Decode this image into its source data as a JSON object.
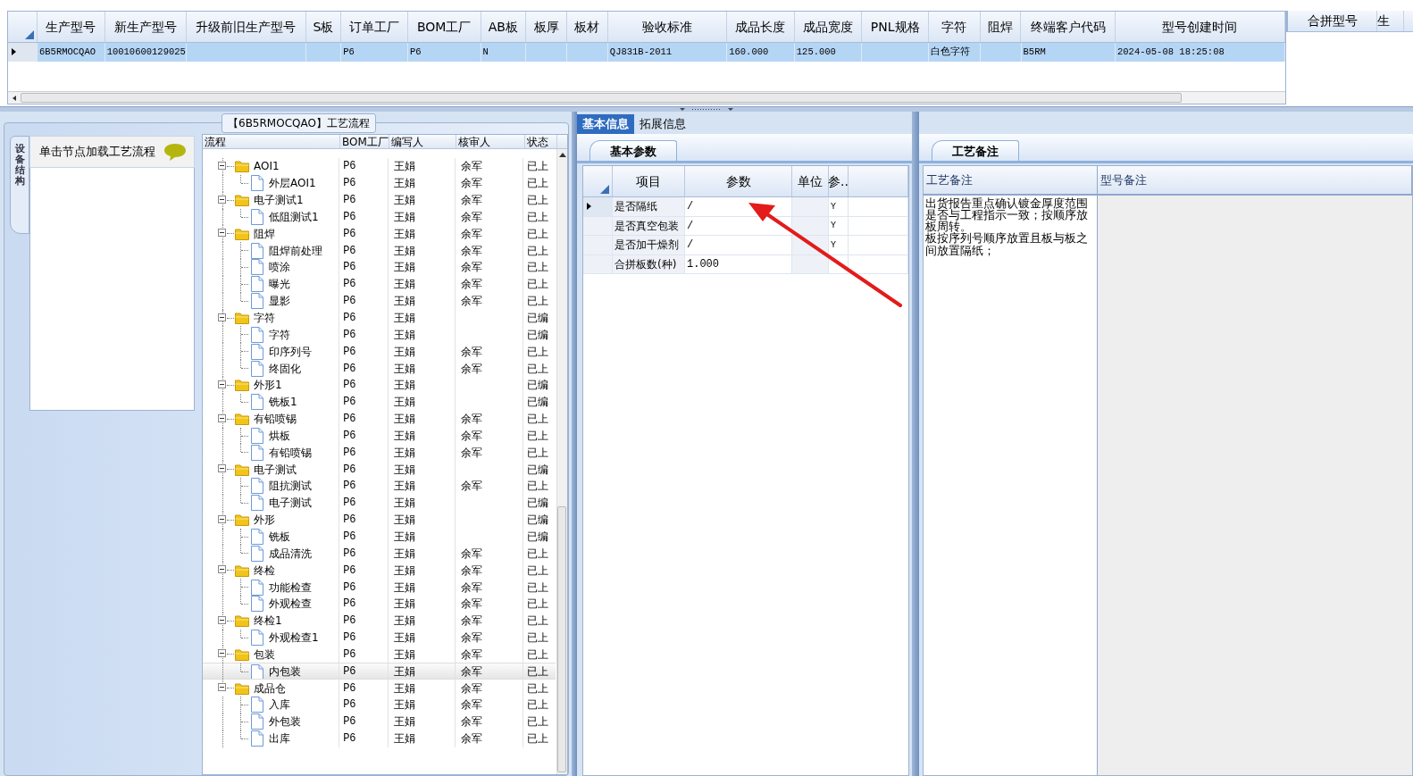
{
  "main_grid": {
    "columns": [
      "生产型号",
      "新生产型号",
      "升级前旧生产型号",
      "S板",
      "订单工厂",
      "BOM工厂",
      "AB板",
      "板厚",
      "板材",
      "验收标准",
      "成品长度",
      "成品宽度",
      "PNL规格",
      "字符",
      "阻焊",
      "终端客户代码",
      "型号创建时间"
    ],
    "rows": [
      {
        "selected": true,
        "cells": [
          "6B5RMOCQAO",
          "10010600129025",
          null,
          null,
          "P6",
          "P6",
          "N",
          null,
          null,
          "QJ831B-2011",
          "160.000",
          "125.000",
          null,
          "白色字符",
          null,
          "B5RM",
          "2024-05-08 18:25:08"
        ]
      }
    ]
  },
  "side_grid": {
    "columns": [
      "合拼型号",
      "生"
    ]
  },
  "process_panel": {
    "title": "【6B5RMOCQAO】工艺流程",
    "side_tab": "设备结构",
    "hint": "单击节点加载工艺流程",
    "tree": {
      "columns": [
        "流程",
        "BOM工厂",
        "编写人",
        "核审人",
        "状态"
      ],
      "nodes": [
        {
          "name": "AOI1",
          "bom": "P6",
          "writer": "王娟",
          "reviewer": "余军",
          "status": "已上",
          "expanded": true,
          "selected": false,
          "children": [
            {
              "name": "外层AOI1",
              "bom": "P6",
              "writer": "王娟",
              "reviewer": "余军",
              "status": "已上",
              "selected": false
            }
          ]
        },
        {
          "name": "电子测试1",
          "bom": "P6",
          "writer": "王娟",
          "reviewer": "余军",
          "status": "已上",
          "expanded": true,
          "selected": false,
          "children": [
            {
              "name": "低阻测试1",
              "bom": "P6",
              "writer": "王娟",
              "reviewer": "余军",
              "status": "已上",
              "selected": false
            }
          ]
        },
        {
          "name": "阻焊",
          "bom": "P6",
          "writer": "王娟",
          "reviewer": "余军",
          "status": "已上",
          "expanded": true,
          "selected": false,
          "children": [
            {
              "name": "阻焊前处理",
              "bom": "P6",
              "writer": "王娟",
              "reviewer": "余军",
              "status": "已上",
              "selected": false
            },
            {
              "name": "喷涂",
              "bom": "P6",
              "writer": "王娟",
              "reviewer": "余军",
              "status": "已上",
              "selected": false
            },
            {
              "name": "曝光",
              "bom": "P6",
              "writer": "王娟",
              "reviewer": "余军",
              "status": "已上",
              "selected": false
            },
            {
              "name": "显影",
              "bom": "P6",
              "writer": "王娟",
              "reviewer": "余军",
              "status": "已上",
              "selected": false
            }
          ]
        },
        {
          "name": "字符",
          "bom": "P6",
          "writer": "王娟",
          "status": "已编",
          "expanded": true,
          "selected": false,
          "children": [
            {
              "name": "字符",
              "bom": "P6",
              "writer": "王娟",
              "status": "已编",
              "selected": false
            },
            {
              "name": "印序列号",
              "bom": "P6",
              "writer": "王娟",
              "reviewer": "余军",
              "status": "已上",
              "selected": false
            },
            {
              "name": "终固化",
              "bom": "P6",
              "writer": "王娟",
              "reviewer": "余军",
              "status": "已上",
              "selected": false
            }
          ]
        },
        {
          "name": "外形1",
          "bom": "P6",
          "writer": "王娟",
          "status": "已编",
          "expanded": true,
          "selected": false,
          "children": [
            {
              "name": "铣板1",
              "bom": "P6",
              "writer": "王娟",
              "status": "已编",
              "selected": false
            }
          ]
        },
        {
          "name": "有铅喷锡",
          "bom": "P6",
          "writer": "王娟",
          "reviewer": "余军",
          "status": "已上",
          "expanded": true,
          "selected": false,
          "children": [
            {
              "name": "烘板",
              "bom": "P6",
              "writer": "王娟",
              "reviewer": "余军",
              "status": "已上",
              "selected": false
            },
            {
              "name": "有铅喷锡",
              "bom": "P6",
              "writer": "王娟",
              "reviewer": "余军",
              "status": "已上",
              "selected": false
            }
          ]
        },
        {
          "name": "电子测试",
          "bom": "P6",
          "writer": "王娟",
          "status": "已编",
          "expanded": true,
          "selected": false,
          "children": [
            {
              "name": "阻抗测试",
              "bom": "P6",
              "writer": "王娟",
              "reviewer": "余军",
              "status": "已上",
              "selected": false
            },
            {
              "name": "电子测试",
              "bom": "P6",
              "writer": "王娟",
              "status": "已编",
              "selected": false
            }
          ]
        },
        {
          "name": "外形",
          "bom": "P6",
          "writer": "王娟",
          "status": "已编",
          "expanded": true,
          "selected": false,
          "children": [
            {
              "name": "铣板",
              "bom": "P6",
              "writer": "王娟",
              "status": "已编",
              "selected": false
            },
            {
              "name": "成品清洗",
              "bom": "P6",
              "writer": "王娟",
              "reviewer": "余军",
              "status": "已上",
              "selected": false
            }
          ]
        },
        {
          "name": "终检",
          "bom": "P6",
          "writer": "王娟",
          "reviewer": "余军",
          "status": "已上",
          "expanded": true,
          "selected": false,
          "children": [
            {
              "name": "功能检查",
              "bom": "P6",
              "writer": "王娟",
              "reviewer": "余军",
              "status": "已上",
              "selected": false
            },
            {
              "name": "外观检查",
              "bom": "P6",
              "writer": "王娟",
              "reviewer": "余军",
              "status": "已上",
              "selected": false
            }
          ]
        },
        {
          "name": "终检1",
          "bom": "P6",
          "writer": "王娟",
          "reviewer": "余军",
          "status": "已上",
          "expanded": true,
          "selected": false,
          "children": [
            {
              "name": "外观检查1",
              "bom": "P6",
              "writer": "王娟",
              "reviewer": "余军",
              "status": "已上",
              "selected": false
            }
          ]
        },
        {
          "name": "包装",
          "bom": "P6",
          "writer": "王娟",
          "reviewer": "余军",
          "status": "已上",
          "expanded": true,
          "selected": false,
          "children": [
            {
              "name": "内包装",
              "bom": "P6",
              "writer": "王娟",
              "reviewer": "余军",
              "status": "已上",
              "selected": true
            }
          ]
        },
        {
          "name": "成品仓",
          "bom": "P6",
          "writer": "王娟",
          "reviewer": "余军",
          "status": "已上",
          "expanded": true,
          "selected": false,
          "children": [
            {
              "name": "入库",
              "bom": "P6",
              "writer": "王娟",
              "reviewer": "余军",
              "status": "已上",
              "selected": false
            },
            {
              "name": "外包装",
              "bom": "P6",
              "writer": "王娟",
              "reviewer": "余军",
              "status": "已上",
              "selected": false
            },
            {
              "name": "出库",
              "bom": "P6",
              "writer": "王娟",
              "reviewer": "余军",
              "status": "已上",
              "selected": false
            }
          ]
        }
      ]
    }
  },
  "detail": {
    "tabs": [
      {
        "label": "基本信息",
        "selected": true
      },
      {
        "label": "拓展信息",
        "selected": false
      }
    ],
    "sub_tab": "基本参数",
    "params": {
      "columns": [
        "项目",
        "参数",
        "单位",
        "参.."
      ],
      "rows": [
        {
          "selected": true,
          "item": "是否隔纸",
          "value": "/",
          "flag": "Y"
        },
        {
          "selected": false,
          "item": "是否真空包装",
          "value": "/",
          "flag": "Y"
        },
        {
          "selected": false,
          "item": "是否加干燥剂",
          "value": "/",
          "flag": "Y"
        },
        {
          "selected": false,
          "item": "合拼板数(种)",
          "value": "1.000"
        }
      ]
    }
  },
  "notes": {
    "sub_tab": "工艺备注",
    "columns": [
      "工艺备注",
      "型号备注"
    ],
    "process_note": [
      "出货报告重点确认镀金厚度范围是否与工程指示一致；按顺序放板周转。",
      "板按序列号顺序放置且板与板之间放置隔纸；"
    ]
  }
}
